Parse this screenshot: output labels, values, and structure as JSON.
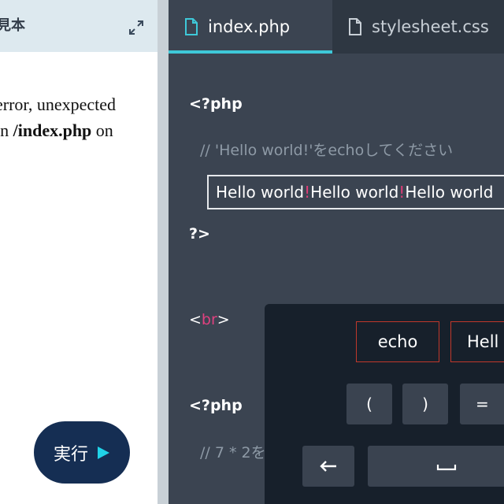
{
  "preview": {
    "title": "見本",
    "error_lines": [
      {
        "pre": "error, unexpected",
        "bold": "",
        "post": ""
      },
      {
        "pre": "in ",
        "bold": "/index.php",
        "post": " on"
      }
    ],
    "run_button_label": "実行"
  },
  "editor": {
    "tabs": [
      {
        "label": "index.php",
        "active": true
      },
      {
        "label": "stylesheet.css",
        "active": false
      }
    ],
    "lines": {
      "php_open_1": "<?php",
      "comment_1": "// 'Hello world!'をechoしてください",
      "php_close_1": "?>",
      "br_open": "<",
      "br_name": "br",
      "br_close": ">",
      "php_open_2": "<?php",
      "comment_2": "// 7 * 2を"
    },
    "answer": {
      "segments": [
        "Hello world",
        "!",
        "Hello world",
        "!",
        "Hello world"
      ]
    }
  },
  "keyboard": {
    "tokens": [
      "echo",
      "Hell"
    ],
    "symbols": [
      "(",
      ")",
      "="
    ],
    "nav": {
      "back": "back-arrow",
      "space": "space-bar"
    }
  },
  "colors": {
    "accent": "#3ec8d8",
    "editor_bg": "#3b4451",
    "keyboard_bg": "#17202b",
    "token_border": "#c0382b",
    "tag_name": "#e0417f",
    "run_button": "#152e53"
  }
}
